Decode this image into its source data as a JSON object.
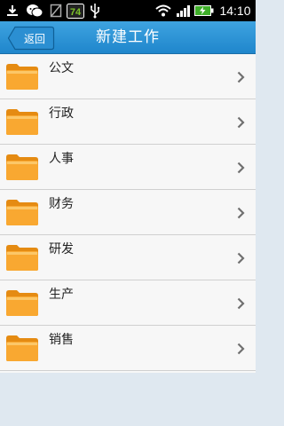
{
  "status_bar": {
    "time": "14:10",
    "battery_level_text": "74",
    "icons": [
      "download-icon",
      "wechat-icon",
      "no-sim-icon",
      "battery-level-icon",
      "usb-icon",
      "wifi-icon",
      "signal-icon",
      "battery-charging-icon"
    ]
  },
  "titlebar": {
    "back_label": "返回",
    "title": "新建工作",
    "accent_color": "#2a92d6"
  },
  "list": {
    "items": [
      {
        "label": "公文",
        "icon": "folder-icon"
      },
      {
        "label": "行政",
        "icon": "folder-icon"
      },
      {
        "label": "人事",
        "icon": "folder-icon"
      },
      {
        "label": "财务",
        "icon": "folder-icon"
      },
      {
        "label": "研发",
        "icon": "folder-icon"
      },
      {
        "label": "生产",
        "icon": "folder-icon"
      },
      {
        "label": "销售",
        "icon": "folder-icon"
      }
    ]
  }
}
